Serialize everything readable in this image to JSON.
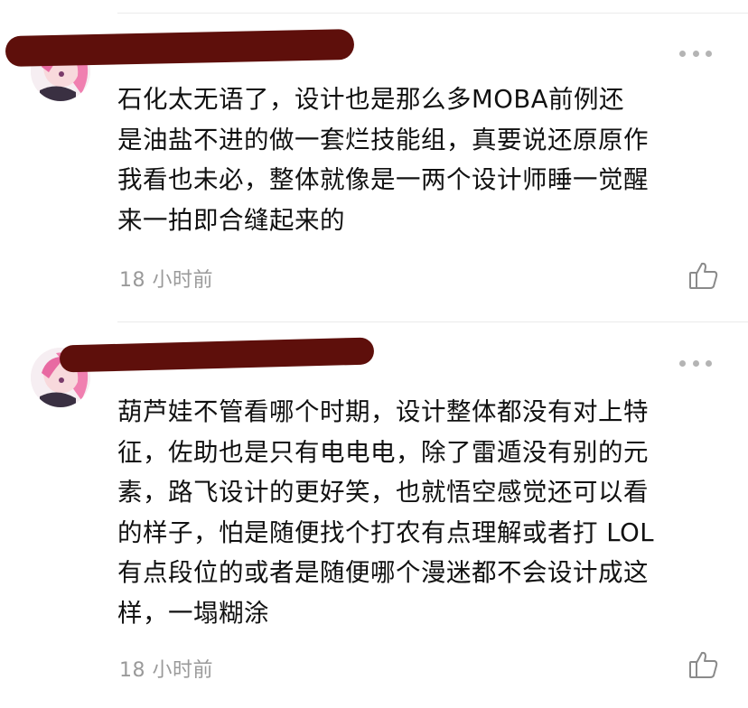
{
  "comments": [
    {
      "text_lines": [
        "石化太无语了，设计也是那么多MOBA前例还",
        "是油盐不进的做一套烂技能组，真要说还原原作",
        "我看也未必，整体就像是一两个设计师睡一觉醒",
        "来一拍即合缝起来的"
      ],
      "time": "18 小时前",
      "icons": {
        "more": "more-dots-icon",
        "like": "thumbs-up-icon"
      }
    },
    {
      "text_lines": [
        "葫芦娃不管看哪个时期，设计整体都没有对上特",
        "征，佐助也是只有电电电，除了雷遁没有别的元",
        "素，路飞设计的更好笑，也就悟空感觉还可以看",
        "的样子，怕是随便找个打农有点理解或者打 LOL",
        "有点段位的或者是随便哪个漫迷都不会设计成这",
        "样，一塌糊涂"
      ],
      "time": "18 小时前",
      "icons": {
        "more": "more-dots-icon",
        "like": "thumbs-up-icon"
      }
    }
  ],
  "colors": {
    "redaction": "#5e0f0b",
    "text": "#111111",
    "meta": "#9a9a9a",
    "divider": "#ebebeb"
  }
}
